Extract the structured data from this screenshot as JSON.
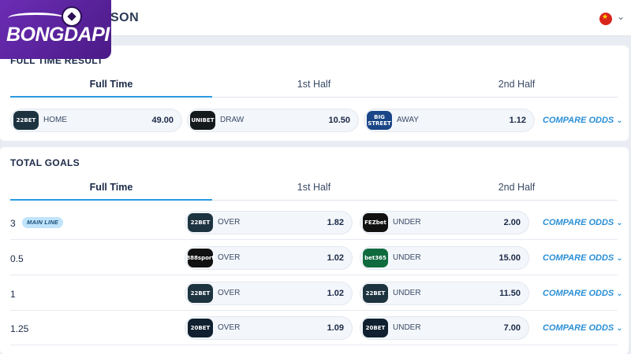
{
  "header": {
    "title_fragment": "SON",
    "logo_text": "BONGDAPI"
  },
  "full_time_result": {
    "heading": "FULL TIME RESULT",
    "tabs": [
      "Full Time",
      "1st Half",
      "2nd Half"
    ],
    "odds": [
      {
        "bookmaker": "22BET",
        "label": "HOME",
        "value": "49.00",
        "color": "#1d3340"
      },
      {
        "bookmaker": "UNIBET",
        "label": "DRAW",
        "value": "10.50",
        "color": "#14191c"
      },
      {
        "bookmaker": "BIG STREET",
        "label": "AWAY",
        "value": "1.12",
        "color": "#1a4687"
      }
    ],
    "compare_label": "COMPARE ODDS"
  },
  "total_goals": {
    "heading": "TOTAL GOALS",
    "tabs": [
      "Full Time",
      "1st Half",
      "2nd Half"
    ],
    "main_line_badge": "MAIN LINE",
    "compare_label": "COMPARE ODDS",
    "rows": [
      {
        "line": "3",
        "over_bm": "22BET",
        "over_color": "#1d3340",
        "over_label": "OVER",
        "over_value": "1.82",
        "under_bm": "FEZbet",
        "under_color": "#111111",
        "under_label": "UNDER",
        "under_value": "2.00"
      },
      {
        "line": "0.5",
        "over_bm": "888sport",
        "over_color": "#111111",
        "over_label": "OVER",
        "over_value": "1.02",
        "under_bm": "bet365",
        "under_color": "#0f6b3d",
        "under_label": "UNDER",
        "under_value": "15.00"
      },
      {
        "line": "1",
        "over_bm": "22BET",
        "over_color": "#1d3340",
        "over_label": "OVER",
        "over_value": "1.02",
        "under_bm": "22BET",
        "under_color": "#1d3340",
        "under_label": "UNDER",
        "under_value": "11.50"
      },
      {
        "line": "1.25",
        "over_bm": "20BET",
        "over_color": "#102030",
        "over_label": "OVER",
        "over_value": "1.09",
        "under_bm": "20BET",
        "under_color": "#102030",
        "under_label": "UNDER",
        "under_value": "7.00"
      }
    ]
  }
}
